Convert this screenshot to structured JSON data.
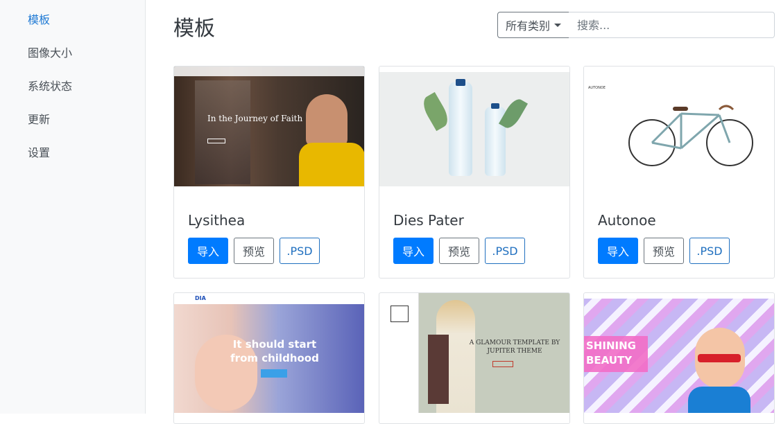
{
  "sidebar": {
    "items": [
      {
        "label": "模板",
        "active": true
      },
      {
        "label": "图像大小"
      },
      {
        "label": "系统状态"
      },
      {
        "label": "更新"
      },
      {
        "label": "设置"
      }
    ]
  },
  "header": {
    "title": "模板",
    "filter_label": "所有类别",
    "search_placeholder": "搜索..."
  },
  "card_buttons": {
    "import": "导入",
    "preview": "预览",
    "psd": ".PSD"
  },
  "cards": [
    {
      "name": "Lysithea",
      "thumb_text": "In the Journey of Faith"
    },
    {
      "name": "Dies Pater"
    },
    {
      "name": "Autonoe",
      "thumb_text": "AUTONOE"
    },
    {
      "name": "",
      "thumb_text": "It should start from childhood",
      "brand": "DIA"
    },
    {
      "name": "",
      "thumb_text": "A GLAMOUR TEMPLATE BY JUPITER THEME"
    },
    {
      "name": "",
      "thumb_text": "SHINING BEAUTY"
    }
  ]
}
